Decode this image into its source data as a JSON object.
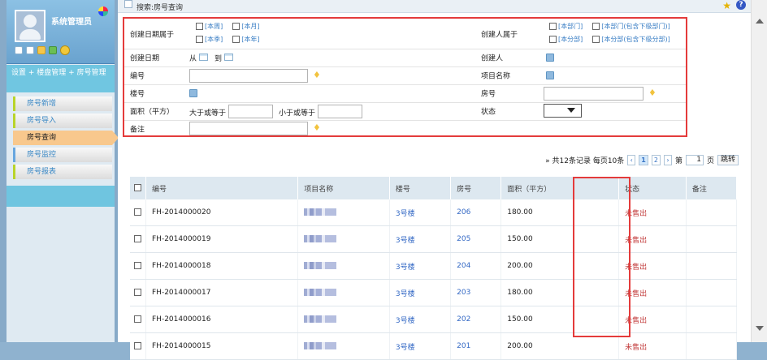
{
  "user": {
    "name": "系统管理员"
  },
  "sidebar": {
    "breadcrumb": "设置 + 楼盘管理 + 房号管理",
    "items": [
      {
        "label": "房号新增"
      },
      {
        "label": "房号导入"
      },
      {
        "label": "房号查询"
      },
      {
        "label": "房号监控"
      },
      {
        "label": "房号报表"
      }
    ]
  },
  "header": {
    "title": "搜索:房号查询"
  },
  "search": {
    "creation_date_range": {
      "label": "创建日期属于",
      "options": [
        "[本周]",
        "[本月]",
        "[本季]",
        "[本年]"
      ]
    },
    "creator_belongs": {
      "label": "创建人属于",
      "options": [
        "[本部门]",
        "[本部门(包含下级部门)]",
        "[本分部]",
        "[本分部(包含下级分部)]"
      ]
    },
    "creation_date": {
      "label": "创建日期",
      "from": "从",
      "to": "到"
    },
    "creator": {
      "label": "创建人"
    },
    "number": {
      "label": "编号"
    },
    "project_name": {
      "label": "项目名称"
    },
    "building": {
      "label": "楼号"
    },
    "room": {
      "label": "房号"
    },
    "area": {
      "label": "面积（平方）",
      "min_label": "大于或等于",
      "max_label": "小于或等于"
    },
    "status": {
      "label": "状态"
    },
    "remark": {
      "label": "备注"
    }
  },
  "pager": {
    "summary": "» 共12条记录  每页10条",
    "pages": [
      "1",
      "2"
    ],
    "page_label": "第",
    "page_value": "1",
    "page_suffix": "页",
    "jump": "跳转"
  },
  "table": {
    "columns": [
      "编号",
      "项目名称",
      "楼号",
      "房号",
      "面积（平方）",
      "状态",
      "备注"
    ],
    "rows": [
      {
        "number": "FH-2014000020",
        "building": "3号楼",
        "room": "206",
        "area": "180.00",
        "status": "未售出"
      },
      {
        "number": "FH-2014000019",
        "building": "3号楼",
        "room": "205",
        "area": "150.00",
        "status": "未售出"
      },
      {
        "number": "FH-2014000018",
        "building": "3号楼",
        "room": "204",
        "area": "200.00",
        "status": "未售出"
      },
      {
        "number": "FH-2014000017",
        "building": "3号楼",
        "room": "203",
        "area": "180.00",
        "status": "未售出"
      },
      {
        "number": "FH-2014000016",
        "building": "3号楼",
        "room": "202",
        "area": "150.00",
        "status": "未售出"
      },
      {
        "number": "FH-2014000015",
        "building": "3号楼",
        "room": "201",
        "area": "200.00",
        "status": "未售出"
      }
    ]
  },
  "icons": {
    "user": "avatar-icon",
    "color": "pie-chart-icon",
    "calendar": "calendar-icon",
    "lookup": "lookup-icon",
    "bulb": "lightbulb-icon",
    "help": "help-icon",
    "star": "star-icon"
  }
}
